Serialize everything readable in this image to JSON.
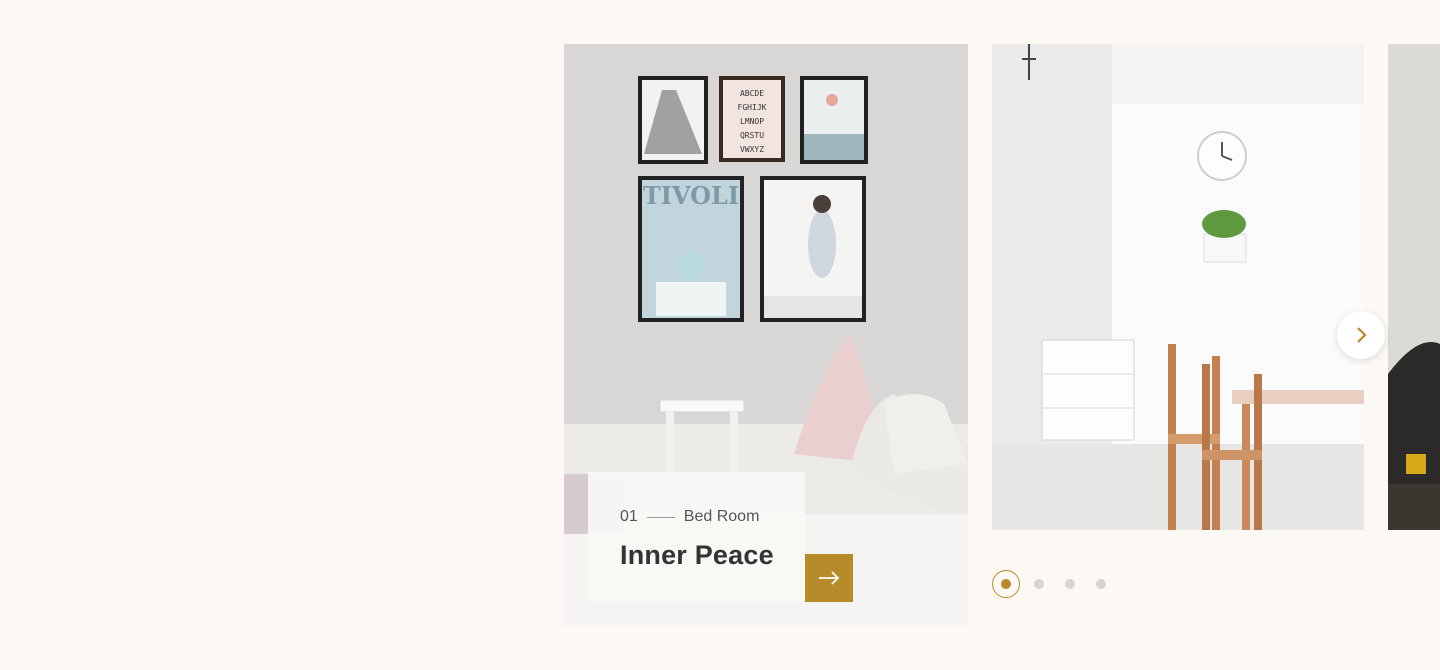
{
  "slides": [
    {
      "number": "01",
      "category": "Bed Room",
      "title": "Inner Peace"
    }
  ],
  "navigation": {
    "next_icon": "chevron-right-icon",
    "arrow_icon": "arrow-right-icon"
  },
  "pagination": {
    "count": 4,
    "active": 0
  },
  "colors": {
    "accent": "#b88b2a",
    "background": "#fcf8f3"
  }
}
